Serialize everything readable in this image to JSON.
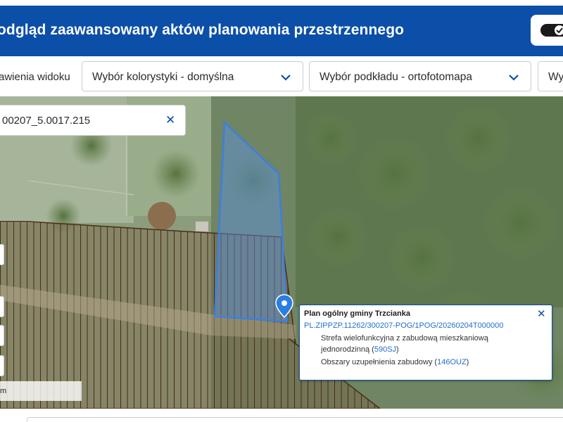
{
  "header": {
    "title": "odgląd zaawansowany aktów planowania przestrzennego",
    "toggle_icon": "check-toggle-icon",
    "colors": {
      "bar": "#0b4fa8",
      "text": "#ffffff"
    }
  },
  "toolbar": {
    "view_settings_label": "awienia widoku",
    "color_scheme_select": {
      "value": "Wybór kolorystyki - domyślna"
    },
    "basemap_select": {
      "value": "Wybór podkładu - ortofotomapa"
    },
    "third_select": {
      "value": "Wy"
    },
    "chevron_icon": "chevron-down-icon"
  },
  "map": {
    "search": {
      "value": "00207_5.0017.215",
      "clear_icon": "close-icon"
    },
    "scale_label": "m",
    "marker_icon": "map-pin-icon",
    "colors": {
      "parcel_outline": "#3d7fe0",
      "parcel_fill": "#5b93e6",
      "zone_hatch": "#4a2e17",
      "marker": "#2a7de1"
    },
    "popup": {
      "title": "Plan ogólny gminy Trzcianka",
      "identifier": "PL.ZIPPZP.11262/300207-POG/1POG/20260204T000000",
      "zone_text_1": "Strefa wielofunkcyjna z zabudową mieszkaniową",
      "zone_text_2": "jednorodzinną (",
      "zone_code": "590SJ",
      "zone_text_3": ")",
      "area_text": "Obszary uzupełnienia zabudowy (",
      "area_code": "146OUZ",
      "area_text_end": ")",
      "close_icon": "close-icon"
    }
  }
}
